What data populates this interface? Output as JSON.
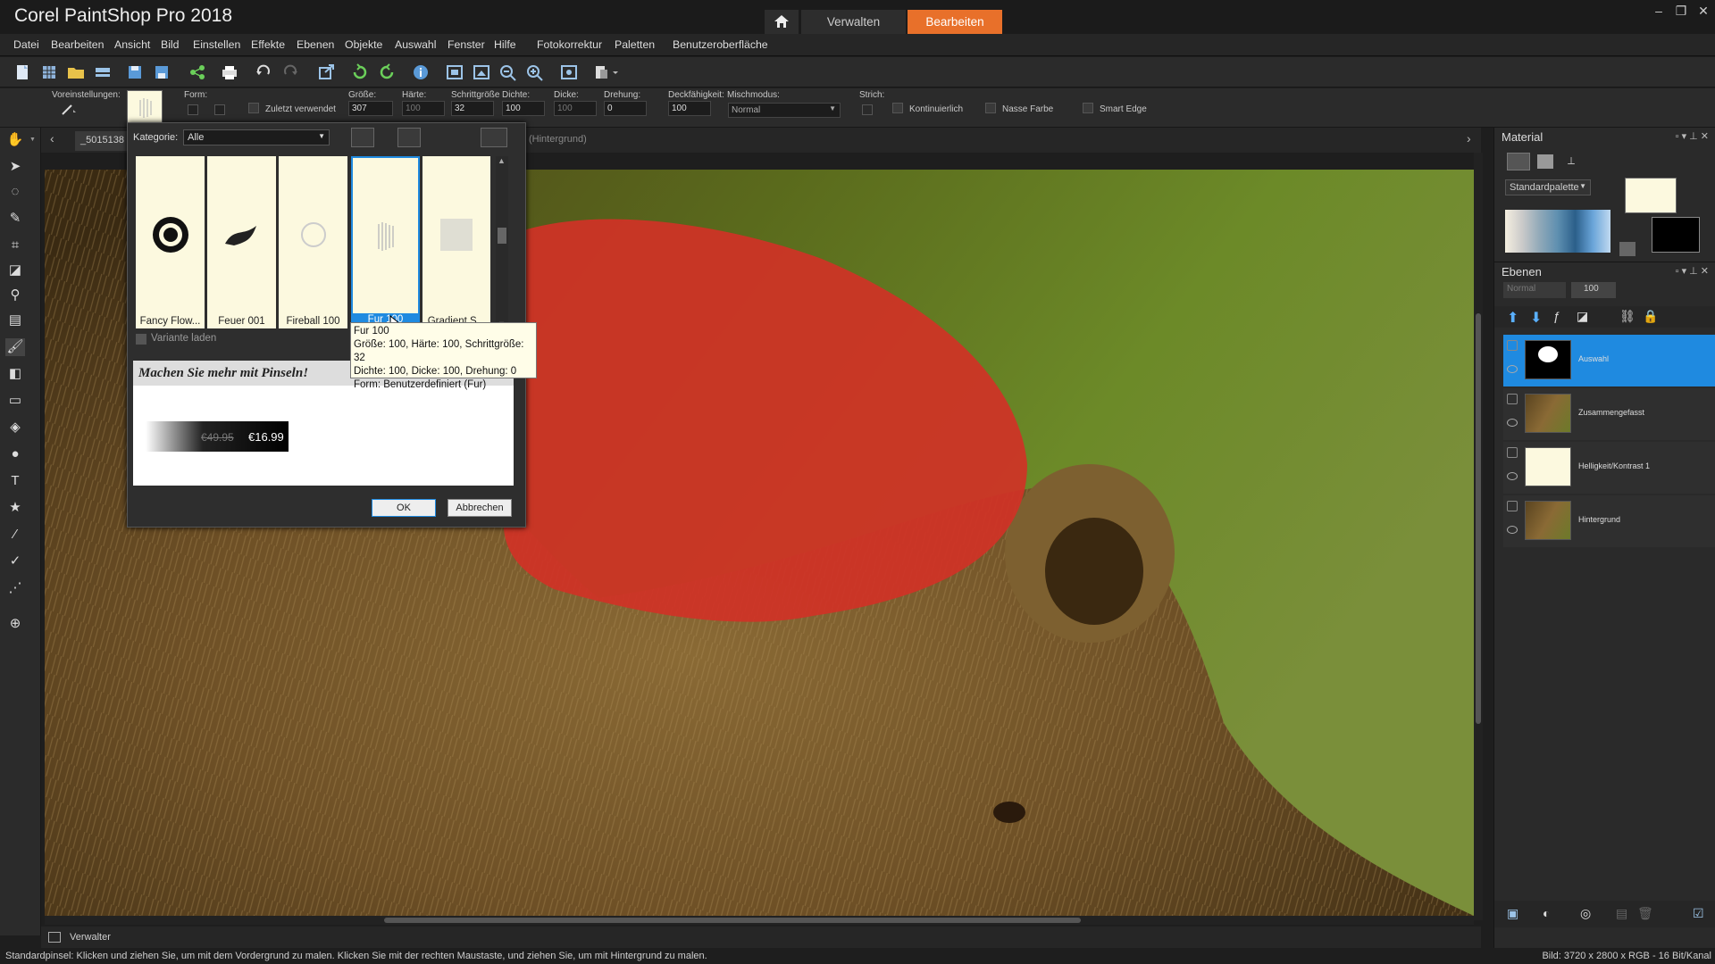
{
  "window": {
    "title": "Corel PaintShop Pro 2018",
    "min": "–",
    "max": "❐",
    "close": "✕"
  },
  "workspaces": {
    "home_icon": "home-icon",
    "manage": "Verwalten",
    "edit": "Bearbeiten"
  },
  "menu": [
    "Datei",
    "Bearbeiten",
    "Ansicht",
    "Bild",
    "Einstellen",
    "Effekte",
    "Ebenen",
    "Objekte",
    "Auswahl",
    "Fenster",
    "Hilfe",
    "Fotokorrektur",
    "Paletten",
    "Benutzeroberfläche"
  ],
  "options": {
    "presets_label": "Voreinstellungen:",
    "shape_label": "Form:",
    "recent_label": "Zuletzt verwendet",
    "size_label": "Größe:",
    "size_value": "307",
    "hardness_label": "Härte:",
    "hardness_value": "100",
    "step_label": "Schrittgröße",
    "step_value": "32",
    "density_label": "Dichte:",
    "density_value": "100",
    "thickness_label": "Dicke:",
    "thickness_value": "100",
    "rotation_label": "Drehung:",
    "rotation_value": "0",
    "opacity_label": "Deckfähigkeit:",
    "opacity_value": "100",
    "blend_label": "Mischmodus:",
    "blend_value": "Normal",
    "stroke_label": "Strich:",
    "continuous_label": "Kontinuierlich",
    "wet_label": "Nasse Farbe",
    "smart_edge_label": "Smart Edge"
  },
  "doc": {
    "tab_name": "_5015138",
    "layer_hint": "(Hintergrund)"
  },
  "dialog": {
    "category_label": "Kategorie:",
    "category_value": "Alle",
    "brushes": [
      {
        "name": "Fancy Flow..."
      },
      {
        "name": "Feuer 001"
      },
      {
        "name": "Fireball 100"
      },
      {
        "name": "Fur 100"
      },
      {
        "name": "Gradient S..."
      }
    ],
    "load_variant_label": "Variante laden",
    "promo_title": "Machen Sie mehr mit Pinseln!",
    "old_price": "€49.95",
    "new_price": "€16.99",
    "ok": "OK",
    "cancel": "Abbrechen"
  },
  "tooltip": {
    "line1": "Fur 100",
    "line2": "Größe: 100, Härte: 100, Schrittgröße: 32",
    "line3": "Dichte: 100, Dicke: 100, Drehung: 0",
    "line4": "Form: Benutzerdefiniert (Fur)"
  },
  "material": {
    "title": "Material",
    "palette_select": "Standardpalette"
  },
  "layers": {
    "title": "Ebenen",
    "mode": "Normal",
    "opacity": "100",
    "items": [
      {
        "name": "Auswahl"
      },
      {
        "name": "Zusammengefasst"
      },
      {
        "name": "Helligkeit/Kontrast 1"
      },
      {
        "name": "Hintergrund"
      }
    ]
  },
  "viewbar": {
    "label": "Verwalter"
  },
  "status": {
    "hint": "Standardpinsel: Klicken und ziehen Sie, um mit dem Vordergrund zu malen. Klicken Sie mit der rechten Maustaste, und ziehen Sie, um mit Hintergrund zu malen.",
    "image_info": "Bild:  3720 x 2800 x RGB - 16 Bit/Kanal"
  },
  "colors": {
    "accent": "#e8702a",
    "selection": "#1f8ae0",
    "mask_red": "#d03226"
  }
}
